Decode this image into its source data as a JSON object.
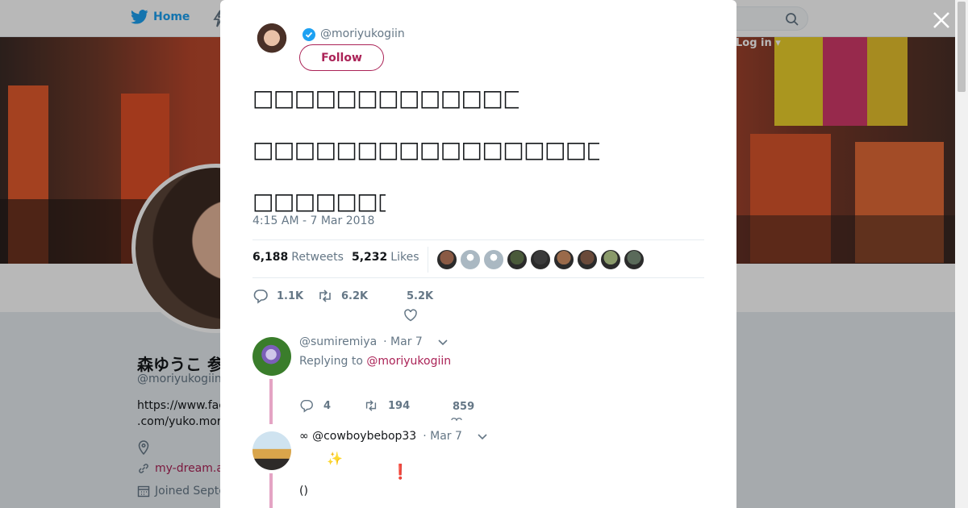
{
  "nav": {
    "home_label": "Home",
    "login_label": "Log in ▾"
  },
  "profile": {
    "name": "森ゆうこ 参議院議員",
    "handle": "@moriyukogiin",
    "url_text": "https://www.facebook\n.com/yuko.mori",
    "website": "my-dream.a",
    "joined": "Joined September"
  },
  "modal": {
    "author_handle": "@moriyukogiin",
    "follow_label": "Follow",
    "tweet_lines": [
      "□□□□□□□□□□□□□□□□□□□□□□□□□□□□□□□",
      "□□□□□□□□□□□□□□□□□□□□□□□□□□□□□□□□□□□□□□□□□□□□□□□□□□□□□□□□□□□□□□□□□□□□□□□□□□□□□□□3□□□□□□□□□□□□□□□□□□□□□□□□□□□□□□□□□□□",
      "□□□□□□□□□□□□□□□□□□□□□□□□□□□□□□□□□□□□□□□□□□□□"
    ],
    "timestamp": "4:15 AM - 7 Mar 2018",
    "retweets_count": "6,188",
    "retweets_label": "Retweets",
    "likes_count": "5,232",
    "likes_label": "Likes",
    "liker_colors": [
      "#8a5a44",
      "#aab8c2",
      "#aab8c2",
      "#4a5a3a",
      "#3a3a3a",
      "#9a6a4a",
      "#6a4a3a",
      "#8a9a6a",
      "#5a6a5a"
    ],
    "reply_count": "1.1K",
    "retweet_count": "6.2K",
    "like_count": "5.2K"
  },
  "replies": [
    {
      "handle": "@sumiremiya",
      "date": "· Mar 7",
      "replying_prefix": "Replying to",
      "replying_to": "@moriyukogiin",
      "replies": "4",
      "retweets": "194",
      "likes": "859"
    },
    {
      "handle": "∞ @cowboybebop33",
      "date": "· Mar 7",
      "sparkle": "✨",
      "exclaim": "❗",
      "parens": "()"
    }
  ]
}
